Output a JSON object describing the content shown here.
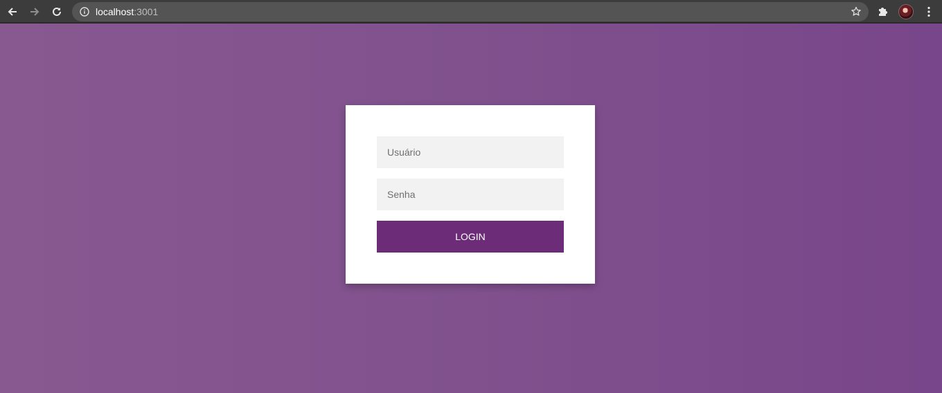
{
  "browser": {
    "url_host": "localhost",
    "url_port": ":3001",
    "icons": [
      "back-arrow-icon",
      "forward-arrow-icon",
      "reload-icon",
      "info-icon",
      "star-icon",
      "puzzle-icon",
      "avatar",
      "menu-dots-icon"
    ]
  },
  "login": {
    "username_placeholder": "Usuário",
    "password_placeholder": "Senha",
    "button_label": "LOGIN"
  },
  "colors": {
    "background": "#80518d",
    "button": "#6c2c78",
    "input_bg": "#f2f2f2",
    "card": "#ffffff"
  }
}
